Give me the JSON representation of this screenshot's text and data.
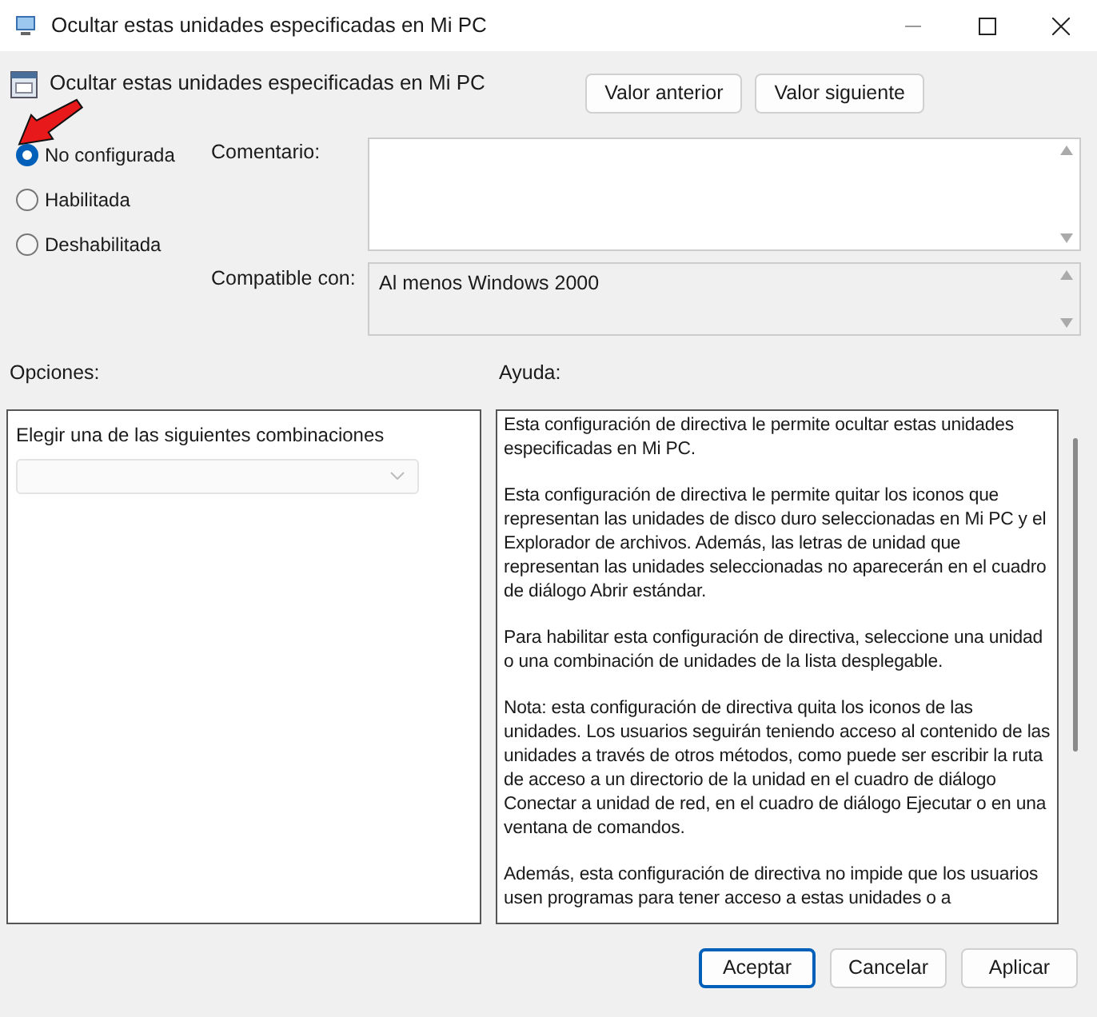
{
  "window": {
    "title": "Ocultar estas unidades especificadas en Mi PC"
  },
  "header": {
    "title": "Ocultar estas unidades especificadas en Mi PC",
    "buttons": [
      "Valor anterior",
      "Valor siguiente"
    ]
  },
  "annotation": {
    "kind": "arrow"
  },
  "states": [
    {
      "label": "No configurada",
      "selected": true
    },
    {
      "label": "Habilitada",
      "selected": false
    },
    {
      "label": "Deshabilitada",
      "selected": false
    }
  ],
  "comment": {
    "label": "Comentario:"
  },
  "compatible": {
    "label": "Compatible con:",
    "value": "Al menos Windows 2000"
  },
  "options": {
    "label": "Opciones:",
    "text": "Elegir una de las siguientes combinaciones",
    "dropdown_disabled": true
  },
  "help": {
    "label": "Ayuda:",
    "paragraphs": [
      "Esta configuración de directiva le permite ocultar estas unidades especificadas en Mi PC.",
      "Esta configuración de directiva le permite quitar los iconos que representan las unidades de disco duro seleccionadas en Mi PC y el Explorador de archivos. Además, las letras de unidad que representan las unidades seleccionadas no aparecerán en el cuadro de diálogo Abrir estándar.",
      "Para habilitar esta configuración de directiva, seleccione una unidad o una combinación de unidades de la lista desplegable.",
      "Nota: esta configuración de directiva quita los iconos de las unidades. Los usuarios seguirán teniendo acceso al contenido de las unidades a través de otros métodos, como puede ser escribir la ruta de acceso a un directorio de la unidad en el cuadro de diálogo Conectar a unidad de red, en el cuadro de diálogo Ejecutar o en una ventana de comandos.",
      "Además, esta configuración de directiva no impide que los usuarios usen programas para tener acceso a estas unidades o a"
    ]
  },
  "footer": {
    "buttons": [
      {
        "label": "Aceptar",
        "default": true
      },
      {
        "label": "Cancelar",
        "default": false
      },
      {
        "label": "Aplicar",
        "default": false
      }
    ]
  }
}
